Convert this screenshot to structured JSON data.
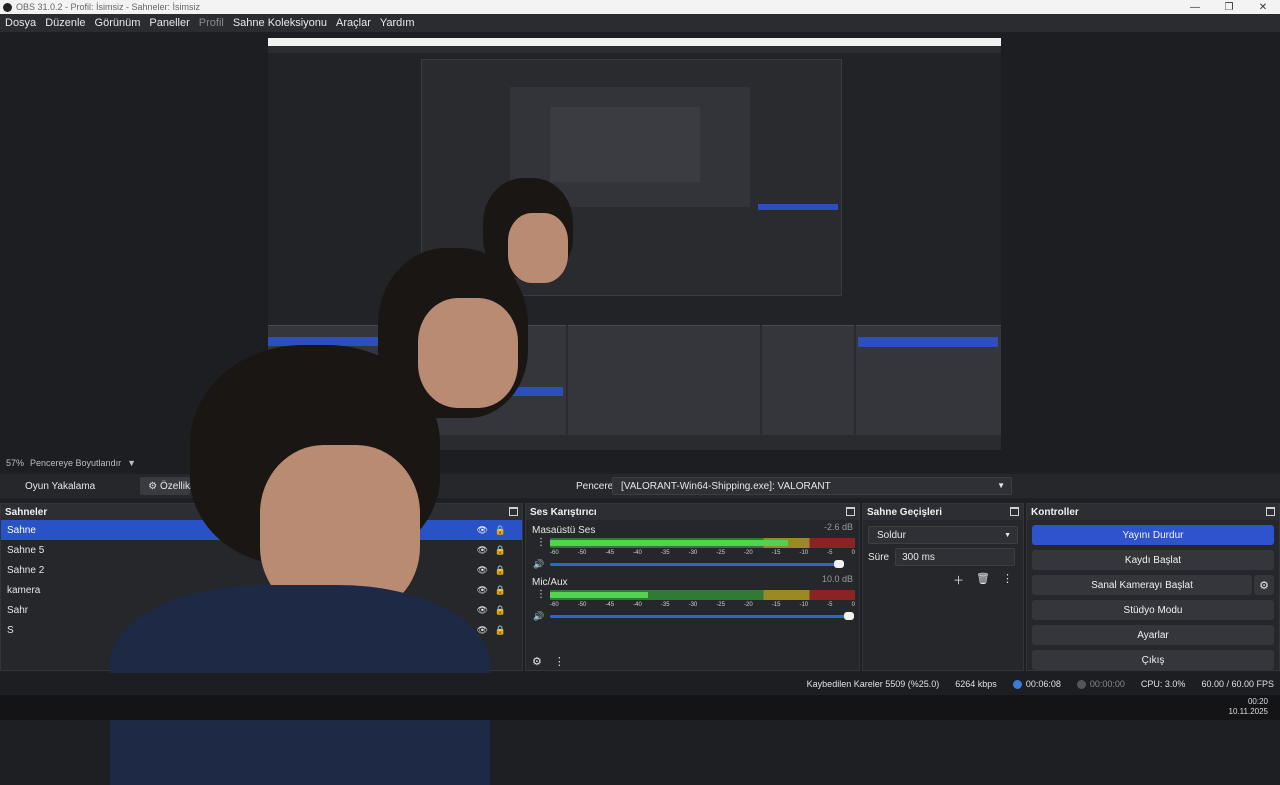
{
  "titlebar": {
    "text": "OBS 31.0.2 - Profil: İsimsiz - Sahneler: İsimsiz"
  },
  "menu": [
    "Dosya",
    "Düzenle",
    "Görünüm",
    "Paneller",
    "Profil",
    "Sahne Koleksiyonu",
    "Araçlar",
    "Yardım"
  ],
  "zoom": {
    "percent": "57%",
    "label": "Pencereye Boyutlandır"
  },
  "source_bar": {
    "source_name": "Oyun Yakalama",
    "properties_label": "Özellikler",
    "window_label": "Pencere",
    "window_value": "[VALORANT-Win64-Shipping.exe]: VALORANT"
  },
  "scenes": {
    "title": "Sahneler",
    "items": [
      "Sahne",
      "Sahne 5",
      "Sahne 2",
      "kamera",
      "Sahr",
      "S"
    ]
  },
  "mixer": {
    "title": "Ses Karıştırıcı",
    "tracks": [
      {
        "name": "Masaüstü Ses",
        "db": "-2.6 dB",
        "level": 0.78
      },
      {
        "name": "Mic/Aux",
        "db": "10.0 dB",
        "level": 0.32
      }
    ],
    "ticks": [
      "-60",
      "-50",
      "-45",
      "-40",
      "-35",
      "-30",
      "-25",
      "-20",
      "-15",
      "-10",
      "-5",
      "0"
    ]
  },
  "transitions": {
    "title": "Sahne Geçişleri",
    "transition": "Soldur",
    "duration_label": "Süre",
    "duration_value": "300 ms"
  },
  "controls": {
    "title": "Kontroller",
    "stop_stream": "Yayını Durdur",
    "start_recording": "Kaydı Başlat",
    "virtual_camera": "Sanal Kamerayı Başlat",
    "studio_mode": "Stüdyo Modu",
    "settings": "Ayarlar",
    "exit": "Çıkış"
  },
  "status": {
    "dropped_frames": "Kaybedilen Kareler 5509 (%25.0)",
    "bitrate": "6264 kbps",
    "stream_time": "00:06:08",
    "record_time": "00:00:00",
    "cpu": "CPU: 3.0%",
    "fps": "60.00 / 60.00 FPS"
  },
  "clock": {
    "time": "00:20",
    "date": "10.11.2025"
  },
  "icons": [
    "gear-icon",
    "plus-icon",
    "trash-icon",
    "kebab-icon",
    "eye-icon",
    "lock-icon",
    "speaker-icon",
    "dock-icon"
  ]
}
